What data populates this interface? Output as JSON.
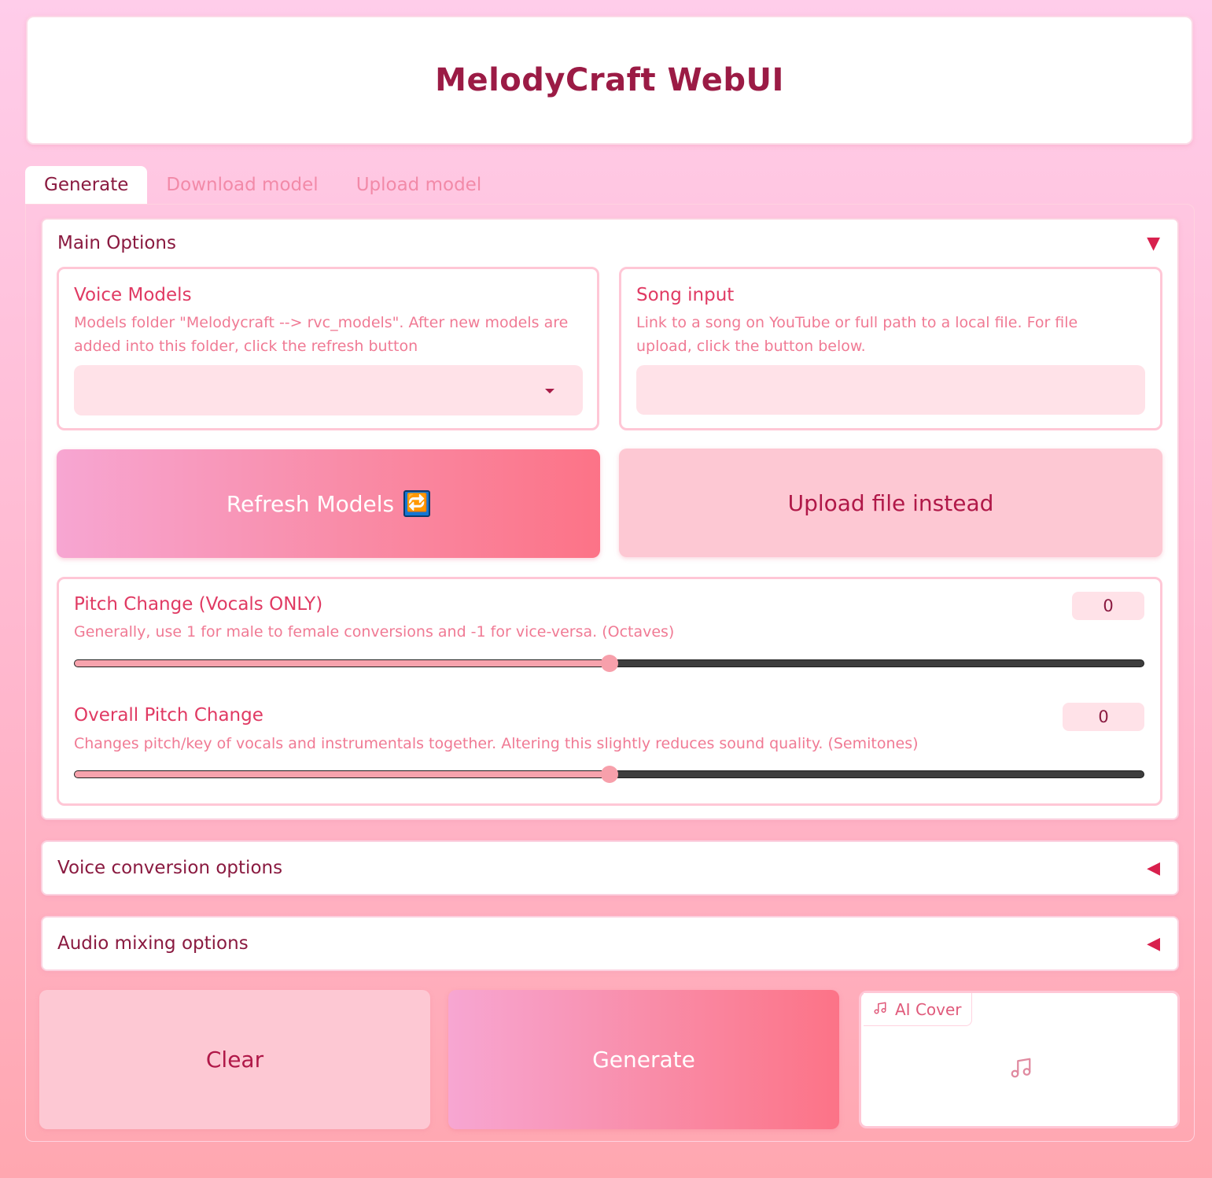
{
  "app": {
    "title": "MelodyCraft WebUI"
  },
  "tabs": [
    {
      "label": "Generate",
      "active": true
    },
    {
      "label": "Download model",
      "active": false
    },
    {
      "label": "Upload model",
      "active": false
    }
  ],
  "main_options": {
    "title": "Main Options",
    "arrow": "▼",
    "voice_models": {
      "label": "Voice Models",
      "info_line1": "Models folder \"Melodycraft --> rvc_models\". After new models are",
      "info_line2": "added into this folder, click the refresh button",
      "value": ""
    },
    "song_input": {
      "label": "Song input",
      "info_line1": "Link to a song on YouTube or full path to a local file. For file",
      "info_line2": "upload, click the button below.",
      "value": ""
    },
    "refresh_button": {
      "label": "Refresh Models",
      "icon": "refresh-icon",
      "icon_glyph": "🔁"
    },
    "upload_button": {
      "label": "Upload file instead"
    },
    "pitch_change": {
      "label": "Pitch Change (Vocals ONLY)",
      "info": "Generally, use 1 for male to female conversions and -1 for vice-versa. (Octaves)",
      "value": "0",
      "fraction": 0.5
    },
    "overall_pitch": {
      "label": "Overall Pitch Change",
      "info": "Changes pitch/key of vocals and instrumentals together. Altering this slightly reduces sound quality. (Semitones)",
      "value": "0",
      "fraction": 0.5
    }
  },
  "voice_conversion": {
    "title": "Voice conversion options",
    "arrow": "◀"
  },
  "audio_mixing": {
    "title": "Audio mixing options",
    "arrow": "◀"
  },
  "actions": {
    "clear_label": "Clear",
    "generate_label": "Generate"
  },
  "output": {
    "label": "AI Cover",
    "icon": "music-note-icon"
  },
  "colors": {
    "accent": "#d8204d",
    "title": "#9b1b45",
    "primary_gradient_start": "#f7a6d2",
    "primary_gradient_end": "#fc7387",
    "secondary_button": "#fdc8d3",
    "input_bg": "#ffe2e8"
  }
}
